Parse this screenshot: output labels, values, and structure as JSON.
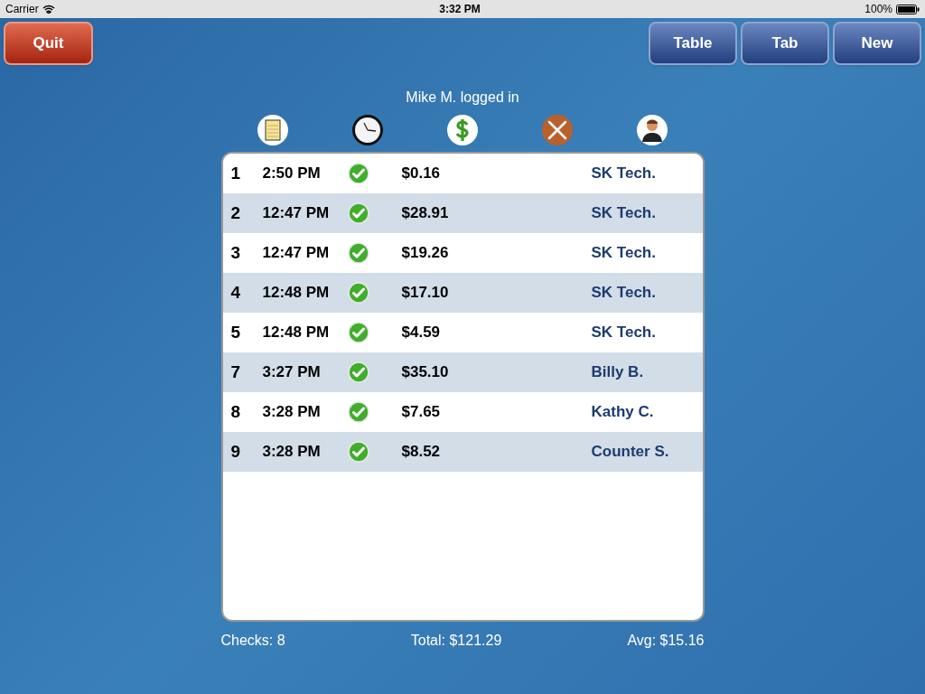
{
  "status_bar": {
    "carrier": "Carrier",
    "time": "3:32 PM",
    "battery": "100%"
  },
  "buttons_left": [
    "Quit"
  ],
  "buttons_right": [
    "Table",
    "Tab",
    "New"
  ],
  "login_text": "Mike M. logged in",
  "rows": [
    {
      "number": "1",
      "time": "2:50 PM",
      "closed": true,
      "amount": "$0.16",
      "server": "SK Tech."
    },
    {
      "number": "2",
      "time": "12:47 PM",
      "closed": true,
      "amount": "$28.91",
      "server": "SK Tech."
    },
    {
      "number": "3",
      "time": "12:47 PM",
      "closed": true,
      "amount": "$19.26",
      "server": "SK Tech."
    },
    {
      "number": "4",
      "time": "12:48 PM",
      "closed": true,
      "amount": "$17.10",
      "server": "SK Tech."
    },
    {
      "number": "5",
      "time": "12:48 PM",
      "closed": true,
      "amount": "$4.59",
      "server": "SK Tech."
    },
    {
      "number": "7",
      "time": "3:27 PM",
      "closed": true,
      "amount": "$35.10",
      "server": "Billy B."
    },
    {
      "number": "8",
      "time": "3:28 PM",
      "closed": true,
      "amount": "$7.65",
      "server": "Kathy C."
    },
    {
      "number": "9",
      "time": "3:28 PM",
      "closed": true,
      "amount": "$8.52",
      "server": "Counter S."
    }
  ],
  "footer": {
    "checks": "Checks: 8",
    "total": "Total: $121.29",
    "avg": "Avg: $15.16"
  }
}
